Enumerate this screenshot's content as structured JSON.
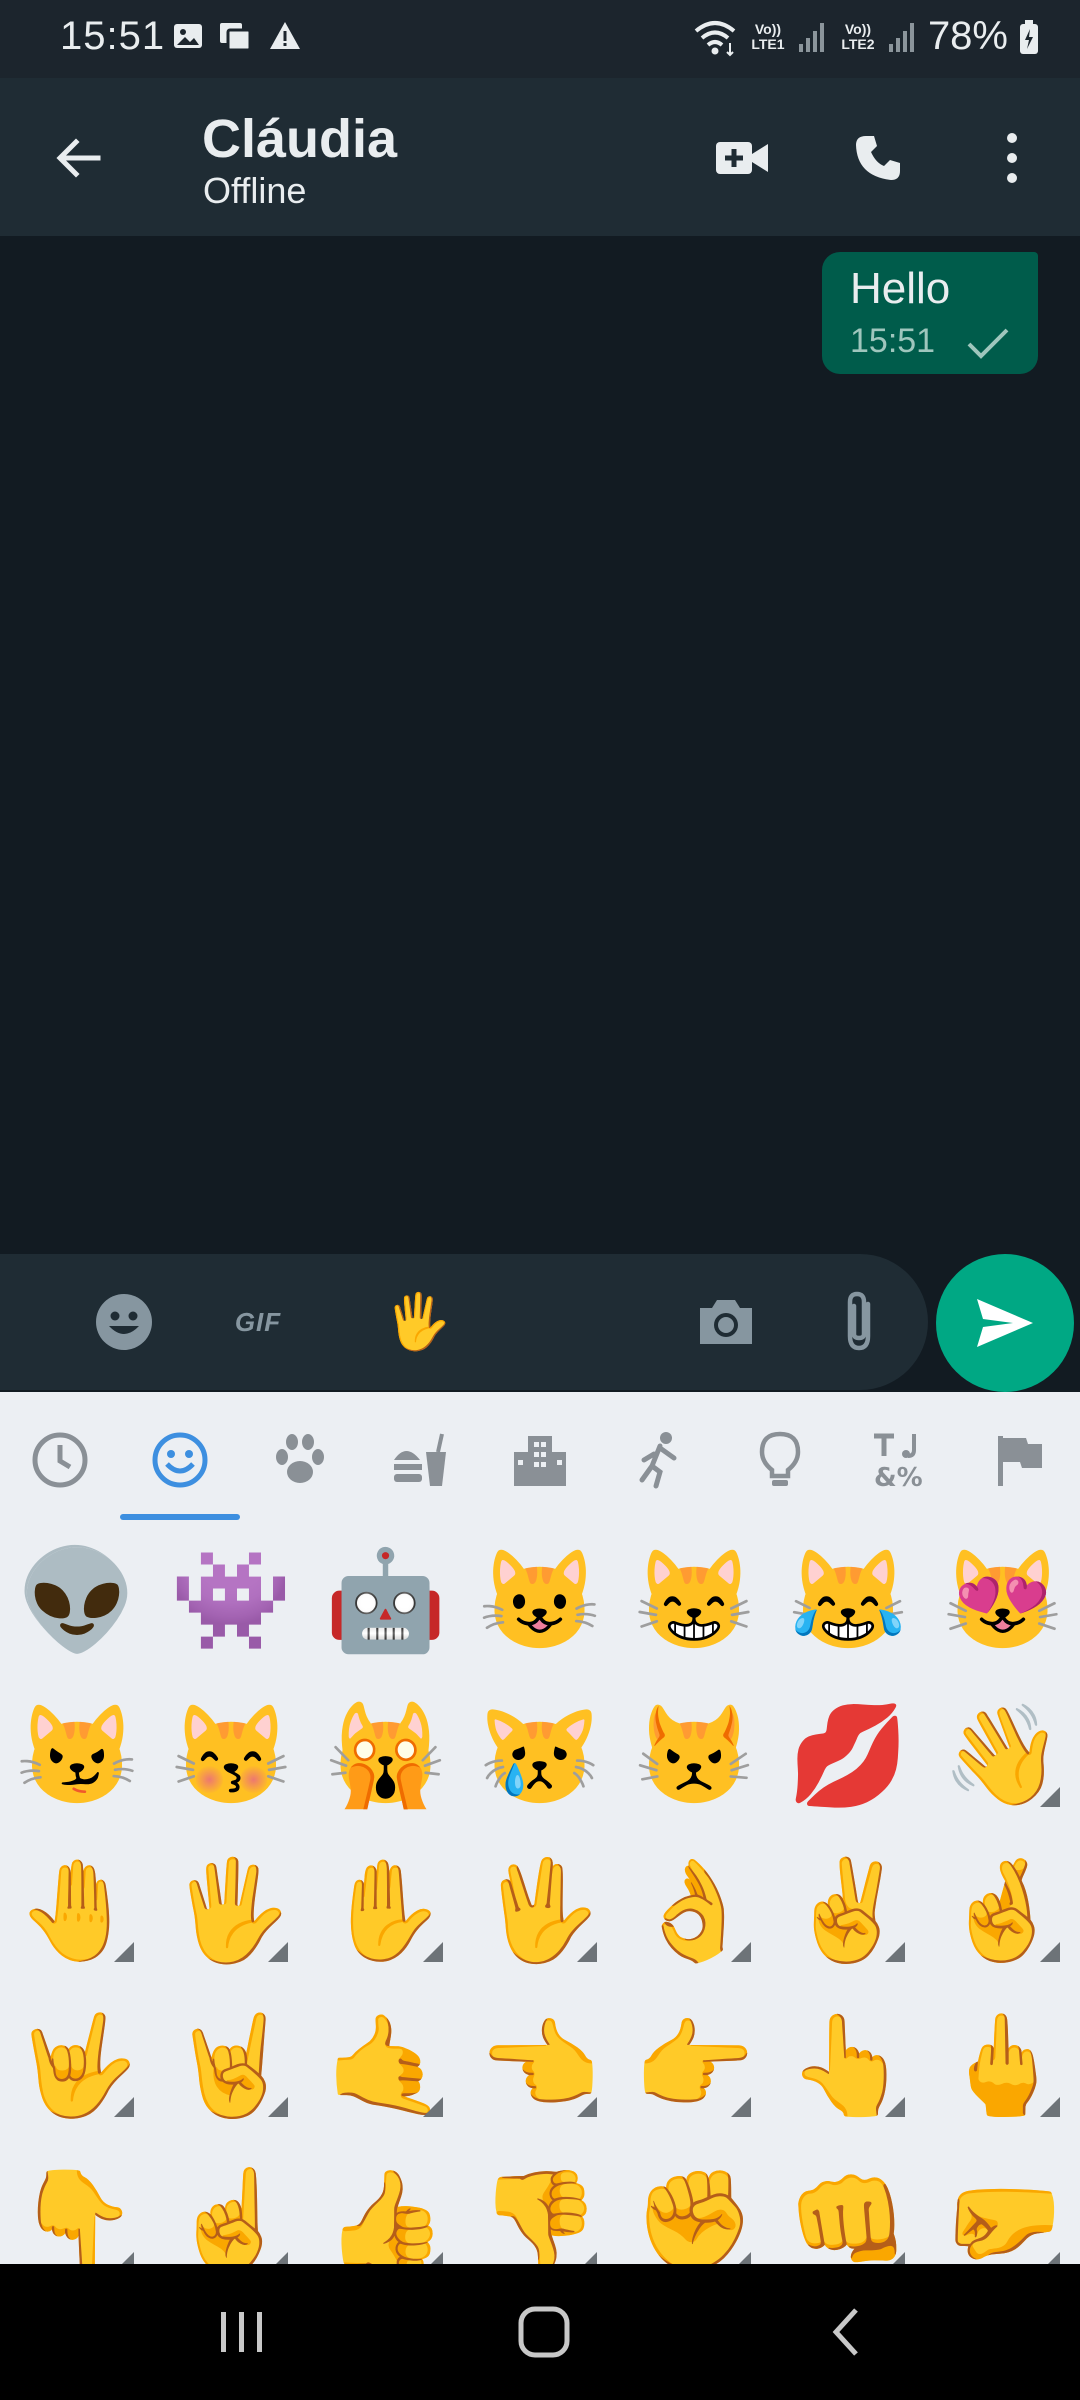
{
  "status_bar": {
    "time": "15:51",
    "battery": "78%",
    "sim1_label": "Vo)) LTE1",
    "sim2_label": "Vo)) LTE2",
    "icons": [
      "gallery-icon",
      "nfc-icon",
      "warning-icon",
      "wifi-icon",
      "signal-icon",
      "battery-icon"
    ]
  },
  "header": {
    "contact_name": "Cláudia",
    "contact_status": "Offline",
    "actions": [
      "video-call-icon",
      "voice-call-icon",
      "more-options-icon"
    ]
  },
  "chat": {
    "messages": [
      {
        "text": "Hello",
        "time": "15:51",
        "direction": "outgoing",
        "status": "sent"
      }
    ]
  },
  "input_bar": {
    "gif_label": "GIF",
    "icons": [
      "emoji-icon",
      "gif-button",
      "sticker-hand-icon",
      "camera-icon",
      "attach-icon"
    ],
    "send_icon": "send-icon"
  },
  "emoji_keyboard": {
    "active_category": 1,
    "categories": [
      "recent",
      "smileys",
      "animals",
      "food",
      "travel",
      "activities",
      "objects",
      "symbols",
      "flags"
    ],
    "rows": [
      [
        {
          "e": "👽",
          "v": false
        },
        {
          "e": "👾",
          "v": false
        },
        {
          "e": "🤖",
          "v": false
        },
        {
          "e": "😺",
          "v": false
        },
        {
          "e": "😸",
          "v": false
        },
        {
          "e": "😹",
          "v": false
        },
        {
          "e": "😻",
          "v": false
        }
      ],
      [
        {
          "e": "😼",
          "v": false
        },
        {
          "e": "😽",
          "v": false
        },
        {
          "e": "🙀",
          "v": false
        },
        {
          "e": "😿",
          "v": false
        },
        {
          "e": "😾",
          "v": false
        },
        {
          "e": "💋",
          "v": false
        },
        {
          "e": "👋",
          "v": true
        }
      ],
      [
        {
          "e": "🤚",
          "v": true
        },
        {
          "e": "🖐",
          "v": true
        },
        {
          "e": "✋",
          "v": true
        },
        {
          "e": "🖖",
          "v": true
        },
        {
          "e": "👌",
          "v": true
        },
        {
          "e": "✌️",
          "v": true
        },
        {
          "e": "🤞",
          "v": true
        }
      ],
      [
        {
          "e": "🤟",
          "v": true
        },
        {
          "e": "🤘",
          "v": true
        },
        {
          "e": "🤙",
          "v": true
        },
        {
          "e": "👈",
          "v": true
        },
        {
          "e": "👉",
          "v": true
        },
        {
          "e": "👆",
          "v": true
        },
        {
          "e": "🖕",
          "v": true
        }
      ],
      [
        {
          "e": "👇",
          "v": true
        },
        {
          "e": "☝️",
          "v": true
        },
        {
          "e": "👍",
          "v": true
        },
        {
          "e": "👎",
          "v": true
        },
        {
          "e": "✊",
          "v": true
        },
        {
          "e": "👊",
          "v": true
        },
        {
          "e": "🤛",
          "v": true
        }
      ]
    ]
  },
  "colors": {
    "header_bg": "#1f2c34",
    "chat_bg": "#121b22",
    "bubble_out": "#005c4b",
    "accent": "#00a884",
    "tab_active": "#3d8fe0"
  },
  "nav_bar": {
    "buttons": [
      "recent-apps-icon",
      "home-icon",
      "back-icon"
    ]
  }
}
